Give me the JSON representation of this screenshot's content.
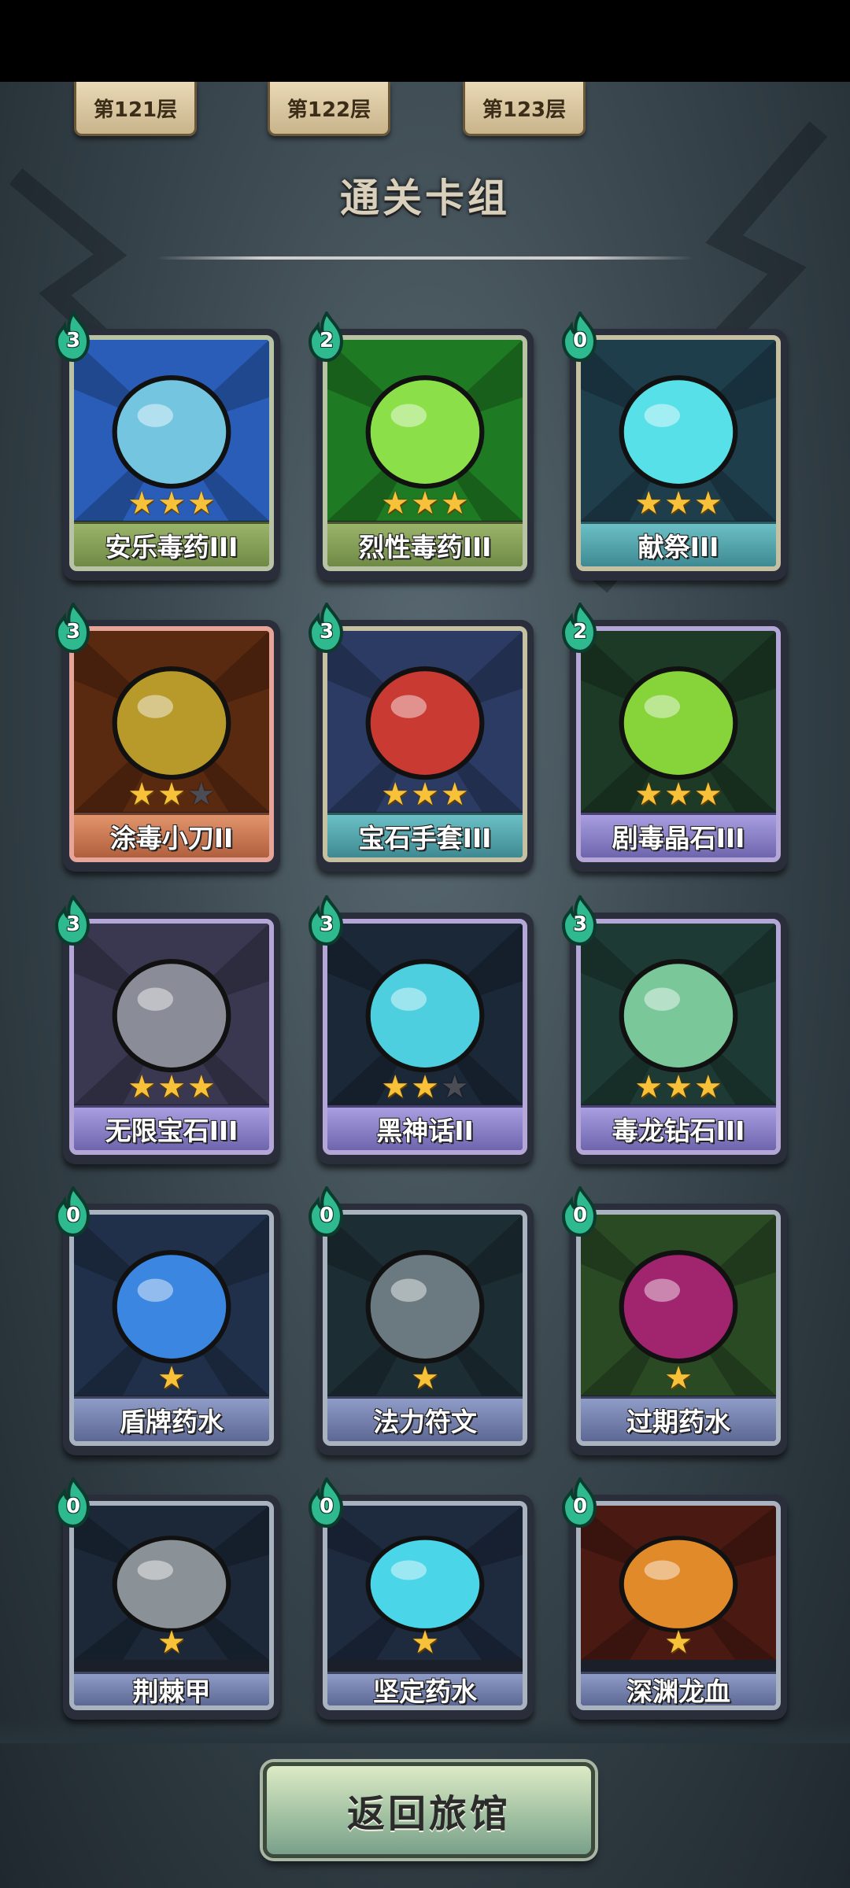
{
  "floors": [
    "第121层",
    "第122层",
    "第123层"
  ],
  "title": "通关卡组",
  "cards": [
    {
      "name": "安乐毒药III",
      "cost": "3",
      "stars": 3,
      "max_stars": 3,
      "rarity": "green",
      "art": "poison-flask-icon",
      "art_colors": [
        "#2a5db8",
        "#74c6e0"
      ]
    },
    {
      "name": "烈性毒药III",
      "cost": "2",
      "stars": 3,
      "max_stars": 3,
      "rarity": "green",
      "art": "green-acid-icon",
      "art_colors": [
        "#1f7a24",
        "#8be04a"
      ]
    },
    {
      "name": "献祭III",
      "cost": "0",
      "stars": 3,
      "max_stars": 3,
      "rarity": "teal",
      "art": "sacrifice-spirit-icon",
      "art_colors": [
        "#1e3e4c",
        "#58e0e8"
      ]
    },
    {
      "name": "涂毒小刀II",
      "cost": "3",
      "stars": 2,
      "max_stars": 3,
      "rarity": "orange",
      "art": "poison-dagger-icon",
      "art_colors": [
        "#5a2a10",
        "#b79a2a"
      ]
    },
    {
      "name": "宝石手套III",
      "cost": "3",
      "stars": 3,
      "max_stars": 3,
      "rarity": "teal",
      "art": "gem-gauntlet-icon",
      "art_colors": [
        "#2b3b63",
        "#c83a32"
      ]
    },
    {
      "name": "剧毒晶石III",
      "cost": "2",
      "stars": 3,
      "max_stars": 3,
      "rarity": "purple",
      "art": "toxic-crystal-icon",
      "art_colors": [
        "#1d3a26",
        "#86d43a"
      ]
    },
    {
      "name": "无限宝石III",
      "cost": "3",
      "stars": 3,
      "max_stars": 3,
      "rarity": "purple",
      "art": "infinity-stone-icon",
      "art_colors": [
        "#3a3850",
        "#8a8c98"
      ]
    },
    {
      "name": "黑神话II",
      "cost": "3",
      "stars": 2,
      "max_stars": 3,
      "rarity": "purple",
      "art": "black-myth-icon",
      "art_colors": [
        "#1b2838",
        "#4ecfe0"
      ]
    },
    {
      "name": "毒龙钻石III",
      "cost": "3",
      "stars": 3,
      "max_stars": 3,
      "rarity": "purple",
      "art": "dragon-diamond-icon",
      "art_colors": [
        "#1e3a34",
        "#7ac79a"
      ]
    },
    {
      "name": "盾牌药水",
      "cost": "0",
      "stars": 1,
      "max_stars": 1,
      "rarity": "blue",
      "art": "shield-potion-icon",
      "art_colors": [
        "#20304a",
        "#3a86e0"
      ]
    },
    {
      "name": "法力符文",
      "cost": "0",
      "stars": 1,
      "max_stars": 1,
      "rarity": "blue",
      "art": "mana-rune-icon",
      "art_colors": [
        "#1d2d34",
        "#6a7a80"
      ]
    },
    {
      "name": "过期药水",
      "cost": "0",
      "stars": 1,
      "max_stars": 1,
      "rarity": "blue",
      "art": "expired-potion-icon",
      "art_colors": [
        "#2a4a24",
        "#a0246e"
      ]
    },
    {
      "name": "荆棘甲",
      "cost": "0",
      "stars": 1,
      "max_stars": 1,
      "rarity": "blue",
      "art": "thorn-armor-icon",
      "art_colors": [
        "#1c2838",
        "#8a9298"
      ]
    },
    {
      "name": "坚定药水",
      "cost": "0",
      "stars": 1,
      "max_stars": 1,
      "rarity": "blue",
      "art": "steadfast-potion-icon",
      "art_colors": [
        "#1e2a3e",
        "#4ad6e8"
      ]
    },
    {
      "name": "深渊龙血",
      "cost": "0",
      "stars": 1,
      "max_stars": 1,
      "rarity": "blue",
      "art": "abyss-dragon-blood-icon",
      "art_colors": [
        "#4a1a12",
        "#e08a2a"
      ]
    }
  ],
  "return_button": "返回旅馆"
}
